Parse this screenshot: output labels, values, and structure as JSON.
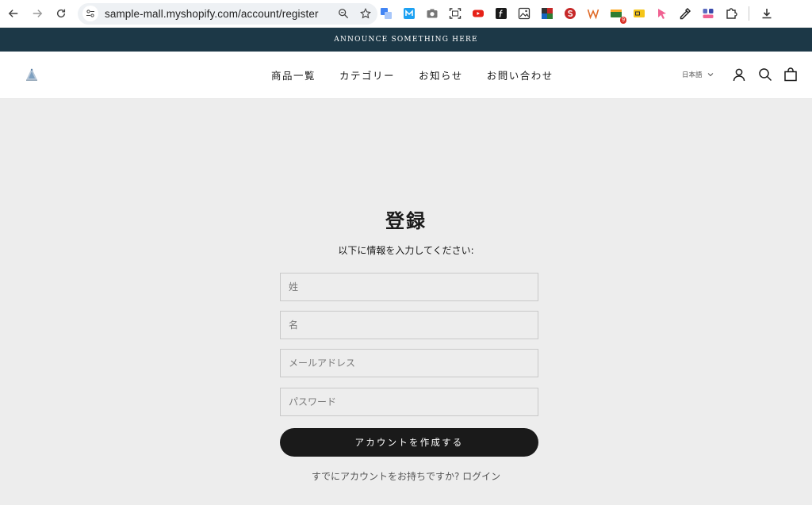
{
  "browser": {
    "url": "sample-mall.myshopify.com/account/register"
  },
  "announcement": {
    "text": "ANNOUNCE SOMETHING HERE"
  },
  "header": {
    "nav": [
      "商品一覧",
      "カテゴリー",
      "お知らせ",
      "お問い合わせ"
    ],
    "language": "日本語"
  },
  "register": {
    "title": "登録",
    "subtitle": "以下に情報を入力してください:",
    "fields": {
      "last_name_placeholder": "姓",
      "first_name_placeholder": "名",
      "email_placeholder": "メールアドレス",
      "password_placeholder": "パスワード"
    },
    "submit_label": "アカウントを作成する",
    "login_prompt": "すでにアカウントをお持ちですか?",
    "login_link": "ログイン"
  },
  "colors": {
    "announcement_bg": "#1c3847",
    "page_bg": "#ededed",
    "button_bg": "#1a1a1a"
  },
  "extensions_badge": "9"
}
